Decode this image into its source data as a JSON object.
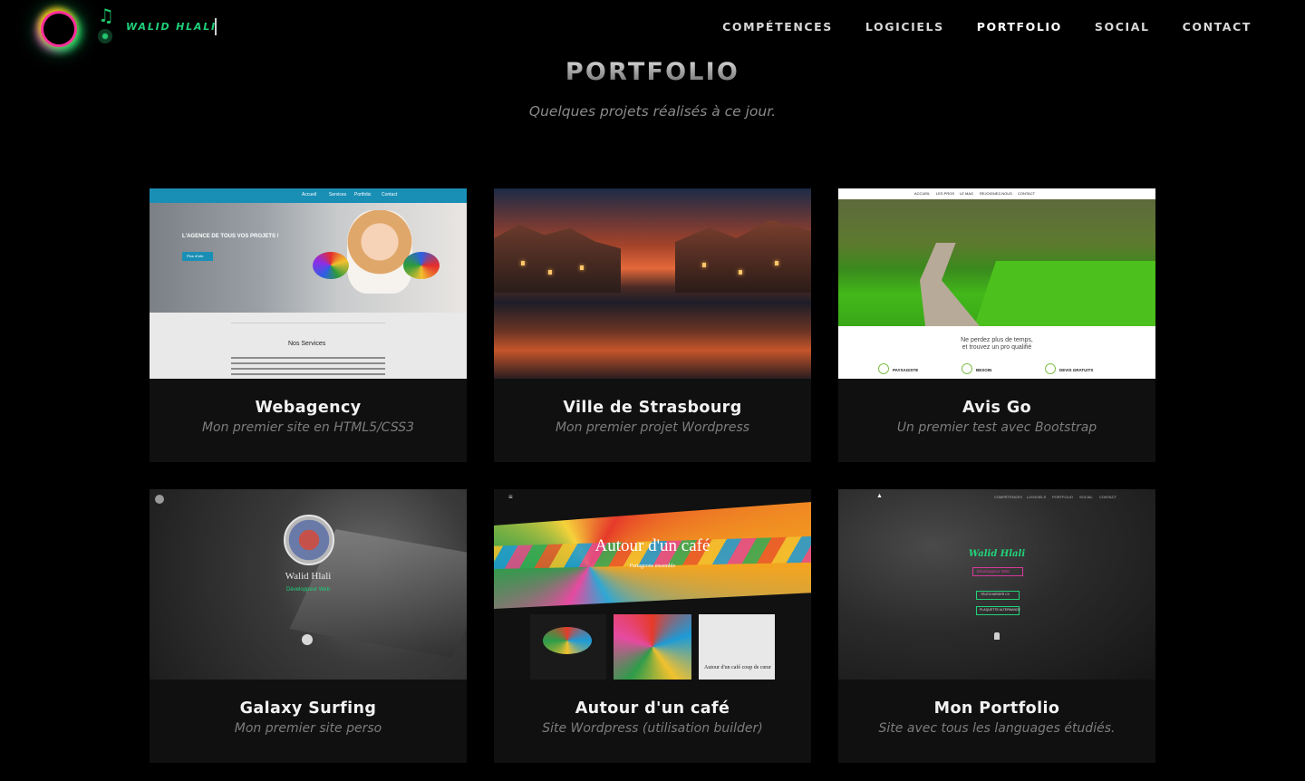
{
  "header": {
    "brand": "WALID HLALI",
    "nav": [
      {
        "label": "COMPÉTENCES",
        "active": false
      },
      {
        "label": "LOGICIELS",
        "active": false
      },
      {
        "label": "PORTFOLIO",
        "active": true
      },
      {
        "label": "SOCIAL",
        "active": false
      },
      {
        "label": "CONTACT",
        "active": false
      }
    ]
  },
  "portfolio": {
    "title": "PORTFOLIO",
    "subtitle": "Quelques projets réalisés à ce jour.",
    "projects": [
      {
        "title": "Webagency",
        "description": "Mon premier site en HTML5/CSS3",
        "thumb": {
          "headline": "L'AGENCE DE TOUS VOS PROJETS !",
          "section": "Nos Services",
          "nav": [
            "Accueil",
            "Services",
            "Portfolio",
            "Contact"
          ],
          "cta": "Plus d'info"
        }
      },
      {
        "title": "Ville de Strasbourg",
        "description": "Mon premier projet Wordpress",
        "thumb": {}
      },
      {
        "title": "Avis Go",
        "description": "Un premier test avec Bootstrap",
        "thumb": {
          "line1": "Ne perdez plus de temps,",
          "line2": "et trouvez un pro qualifié",
          "steps": [
            "PAYSAGISTE",
            "BESOIN",
            "DEVIS GRATUITS"
          ],
          "nav": [
            "ACCUEIL",
            "LES PROS",
            "LE MAG",
            "REJOIGNEZ-NOUS",
            "CONTACT"
          ]
        }
      },
      {
        "title": "Galaxy Surfing",
        "description": "Mon premier site perso",
        "thumb": {
          "name": "Walid Hlali",
          "role": "Développeur Web"
        }
      },
      {
        "title": "Autour d'un café",
        "description": "Site Wordpress (utilisation builder)",
        "thumb": {
          "heading": "Autour d'un café",
          "tagline": "Partageons ensemble",
          "caption": "Autour d'un café coup de cœur"
        }
      },
      {
        "title": "Mon Portfolio",
        "description": "Site avec tous les languages étudiés.",
        "thumb": {
          "sig": "Walid Hlali",
          "role": "Développeur Web",
          "btn1": "TÉLÉCHARGER CV",
          "btn2": "PLAQUETTE ALTERNANCE",
          "nav": [
            "COMPÉTENCES",
            "LOGICIELS",
            "PORTFOLIO",
            "SOCIAL",
            "CONTACT"
          ]
        }
      }
    ]
  },
  "colors": {
    "background": "#000000",
    "accent": "#1fd07a",
    "card": "#101010",
    "muted_text": "#7c7c7c"
  },
  "icons": [
    "logo-ring-icon",
    "music-note-icon",
    "disc-icon",
    "down-arrow-icon",
    "lamp-icon"
  ]
}
